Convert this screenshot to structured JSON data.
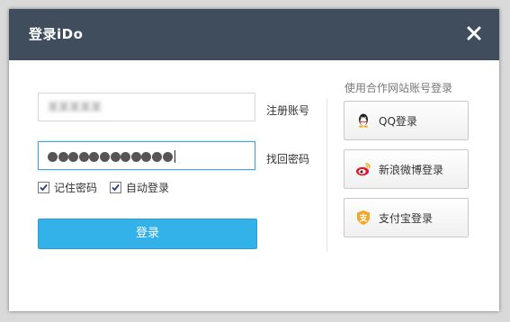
{
  "dialog": {
    "title": "登录iDo",
    "close_glyph": "✕"
  },
  "form": {
    "username_value": "某某某某某",
    "password_dot_count": 12,
    "register_link": "注册账号",
    "forgot_link": "找回密码",
    "remember_label": "记住密码",
    "remember_checked": true,
    "auto_login_label": "自动登录",
    "auto_login_checked": true,
    "login_button": "登录"
  },
  "partner": {
    "heading": "使用合作网站账号登录",
    "buttons": [
      {
        "label": "QQ登录",
        "icon": "qq-penguin-icon"
      },
      {
        "label": "新浪微博登录",
        "icon": "weibo-icon"
      },
      {
        "label": "支付宝登录",
        "icon": "alipay-icon"
      }
    ]
  },
  "colors": {
    "titlebar": "#3f4d5c",
    "login_button": "#33b2ea",
    "focus_border": "#4a9fd8"
  }
}
